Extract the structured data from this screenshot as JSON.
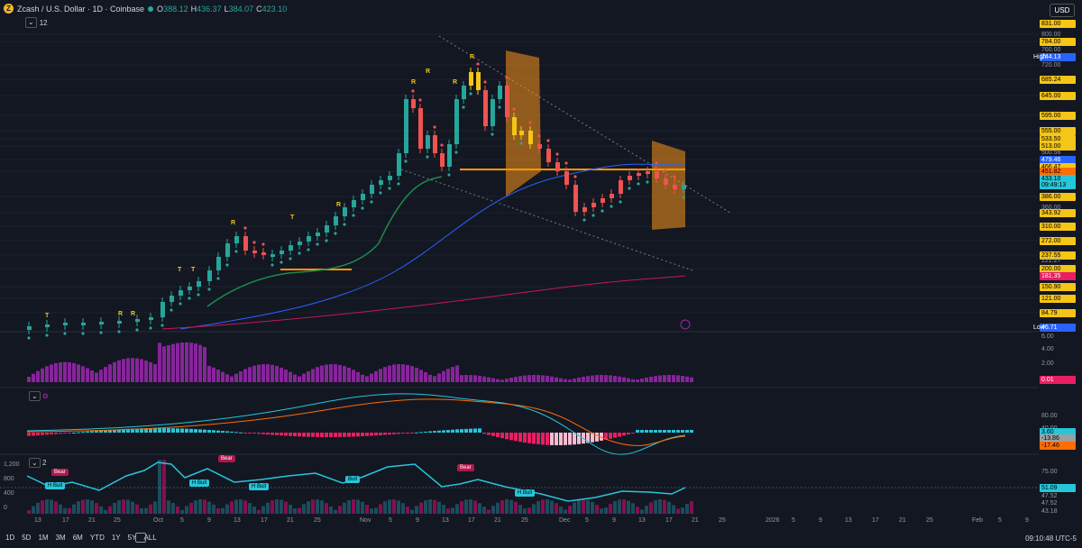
{
  "header": {
    "symbol_title": "Zcash / U.S. Dollar · 1D · Coinbase",
    "coin_letter": "Z",
    "ohlc": [
      {
        "k": "O",
        "v": "388.12"
      },
      {
        "k": "H",
        "v": "436.37"
      },
      {
        "k": "L",
        "v": "384.07"
      },
      {
        "k": "C",
        "v": "423.10"
      }
    ],
    "indicator_count": "12",
    "currency": "USD"
  },
  "price_axis": {
    "labels": [
      {
        "t": "831.00",
        "s": "y"
      },
      {
        "t": "800.00",
        "s": "t"
      },
      {
        "t": "784.00",
        "s": "y"
      },
      {
        "t": "760.00",
        "s": "t"
      },
      {
        "t": "744.13",
        "s": "b"
      },
      {
        "t": "720.00",
        "s": "t"
      },
      {
        "t": "685.24",
        "s": "y"
      },
      {
        "t": "645.00",
        "s": "y"
      },
      {
        "t": "595.00",
        "s": "y"
      },
      {
        "t": "555.00",
        "s": "y"
      },
      {
        "t": "533.50",
        "s": "y"
      },
      {
        "t": "513.00",
        "s": "y"
      },
      {
        "t": "500.56",
        "s": "t"
      },
      {
        "t": "479.46",
        "s": "b"
      },
      {
        "t": "466.47",
        "s": "y"
      },
      {
        "t": "451.82",
        "s": "o"
      },
      {
        "t": "433.10",
        "s": "c"
      },
      {
        "t": "09:49:13",
        "s": "c"
      },
      {
        "t": "386.00",
        "s": "y"
      },
      {
        "t": "360.00",
        "s": "t"
      },
      {
        "t": "343.92",
        "s": "y"
      },
      {
        "t": "310.00",
        "s": "y"
      },
      {
        "t": "272.00",
        "s": "y"
      },
      {
        "t": "237.55",
        "s": "y"
      },
      {
        "t": "221.27",
        "s": "t"
      },
      {
        "t": "200.00",
        "s": "y"
      },
      {
        "t": "181.35",
        "s": "p"
      },
      {
        "t": "150.90",
        "s": "y"
      },
      {
        "t": "121.00",
        "s": "y"
      },
      {
        "t": "84.79",
        "s": "y"
      },
      {
        "t": "46.71",
        "s": "b"
      }
    ],
    "high_label": "High",
    "low_label": "Low"
  },
  "volume_axis": [
    "6.00",
    "4.00",
    "2.00",
    "0.01"
  ],
  "macd_axis": [
    "80.00",
    "40.00",
    "3.60",
    "-13.86",
    "-17.46"
  ],
  "rsi_axis": [
    "75.00",
    "51.09",
    "47.52",
    "47.52",
    "43.18"
  ],
  "rsi_left_axis": [
    "1,200",
    "800",
    "400",
    "0"
  ],
  "rsi_panel_badge": "2",
  "signals": {
    "r_marks": [
      "R",
      "R",
      "R",
      "R",
      "R",
      "R",
      "R",
      "R"
    ],
    "t_marks": [
      "T",
      "T",
      "T",
      "T"
    ],
    "ann": [
      {
        "t": "Bear",
        "type": "bear"
      },
      {
        "t": "Bear",
        "type": "bear"
      },
      {
        "t": "Bear",
        "type": "bear"
      },
      {
        "t": "H Bull",
        "type": "bull"
      },
      {
        "t": "H Bull",
        "type": "bull"
      },
      {
        "t": "H Bull",
        "type": "bull"
      },
      {
        "t": "Bull",
        "type": "bull"
      },
      {
        "t": "H Bull",
        "type": "bull"
      }
    ]
  },
  "x_axis": [
    "13",
    "17",
    "21",
    "25",
    "Oct",
    "5",
    "9",
    "13",
    "17",
    "21",
    "25",
    "Nov",
    "5",
    "9",
    "13",
    "17",
    "21",
    "25",
    "Dec",
    "5",
    "9",
    "13",
    "17",
    "21",
    "25",
    "2026",
    "5",
    "9",
    "13",
    "17",
    "21",
    "25",
    "Feb",
    "5",
    "9"
  ],
  "bottom_bar": {
    "timeframes": [
      "1D",
      "5D",
      "1M",
      "3M",
      "6M",
      "YTD",
      "1Y",
      "5Y",
      "ALL"
    ],
    "clock": "09:10:48 UTC-5"
  },
  "colors": {
    "up": "#26a69a",
    "down": "#ef5350",
    "bg": "#131722",
    "orange": "#f7931a"
  }
}
